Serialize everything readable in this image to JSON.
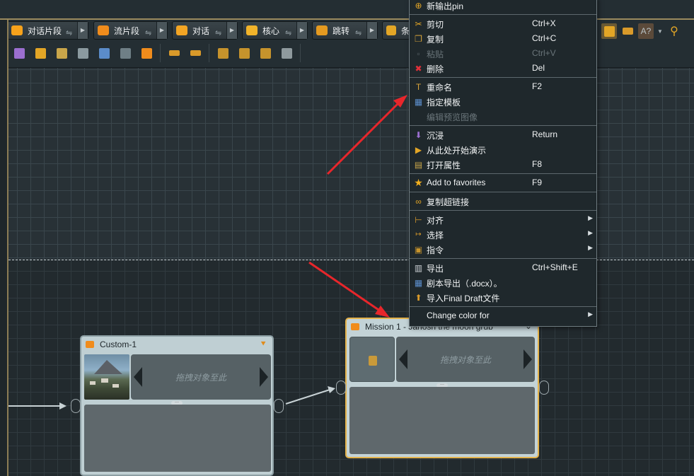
{
  "toolbar": {
    "object_buttons": [
      {
        "label": "对话片段",
        "color": "#f7a21b"
      },
      {
        "label": "流片段",
        "color": "#f08c1c"
      },
      {
        "label": "对话",
        "color": "#f3a524"
      },
      {
        "label": "核心",
        "color": "#f1b32a"
      },
      {
        "label": "跳转",
        "color": "#e59a20"
      },
      {
        "label": "条",
        "color": "#e3a626"
      }
    ],
    "row2_icons": [
      "immerse-icon",
      "play-from-here-icon",
      "properties-icon",
      "bucket-icon",
      "template-icon",
      "structure-icon",
      "forward-icon",
      "align-left-icon",
      "align-right-icon",
      "stack-icon",
      "move-up-icon",
      "move-down-icon",
      "copy-stack-icon"
    ],
    "right_icons": [
      "node-view-icon",
      "graph-icon",
      "spellcheck-icon",
      "zoom-icon"
    ]
  },
  "nodes": [
    {
      "title": "Custom-1",
      "drop_hint": "拖拽对象至此"
    },
    {
      "title": "Mission 1 - Janosh the moon grub",
      "drop_hint": "拖拽对象至此"
    }
  ],
  "context_menu": {
    "items": [
      {
        "label": "新输出pin",
        "key": "",
        "icon": "new-output-pin-icon",
        "enabled": true
      },
      {
        "label": "剪切",
        "key": "Ctrl+X",
        "icon": "scissors-icon",
        "enabled": true
      },
      {
        "label": "复制",
        "key": "Ctrl+C",
        "icon": "copy-icon",
        "enabled": true
      },
      {
        "label": "粘贴",
        "key": "Ctrl+V",
        "icon": "paste-icon",
        "enabled": false
      },
      {
        "label": "删除",
        "key": "Del",
        "icon": "delete-icon",
        "enabled": true
      },
      {
        "label": "重命名",
        "key": "F2",
        "icon": "rename-icon",
        "enabled": true
      },
      {
        "label": "指定模板",
        "key": "",
        "icon": "template-icon",
        "enabled": true
      },
      {
        "label": "编辑预览图像",
        "key": "",
        "icon": "",
        "enabled": false
      },
      {
        "label": "沉浸",
        "key": "Return",
        "icon": "immerse-icon",
        "enabled": true
      },
      {
        "label": "从此处开始演示",
        "key": "",
        "icon": "play-icon",
        "enabled": true
      },
      {
        "label": "打开属性",
        "key": "F8",
        "icon": "properties-icon",
        "enabled": true
      },
      {
        "label": "Add to favorites",
        "key": "F9",
        "icon": "star-icon",
        "enabled": true
      },
      {
        "label": "复制超链接",
        "key": "",
        "icon": "link-icon",
        "enabled": true
      },
      {
        "label": "对齐",
        "key": "",
        "icon": "align-icon",
        "enabled": true
      },
      {
        "label": "选择",
        "key": "",
        "icon": "select-icon",
        "enabled": true
      },
      {
        "label": "指令",
        "key": "",
        "icon": "command-icon",
        "enabled": true
      },
      {
        "label": "导出",
        "key": "Ctrl+Shift+E",
        "icon": "export-icon",
        "enabled": true
      },
      {
        "label": "剧本导出（.docx）。",
        "key": "",
        "icon": "script-export-icon",
        "enabled": true
      },
      {
        "label": "导入Final Draft文件",
        "key": "",
        "icon": "import-icon",
        "enabled": true
      },
      {
        "label": "Change color for",
        "key": "",
        "icon": "",
        "enabled": true
      }
    ]
  },
  "colors": {
    "accent": "#e4b24a",
    "annotation_arrow": "#e8262b",
    "canvas": "#283136",
    "menu_bg": "#1f282c"
  }
}
